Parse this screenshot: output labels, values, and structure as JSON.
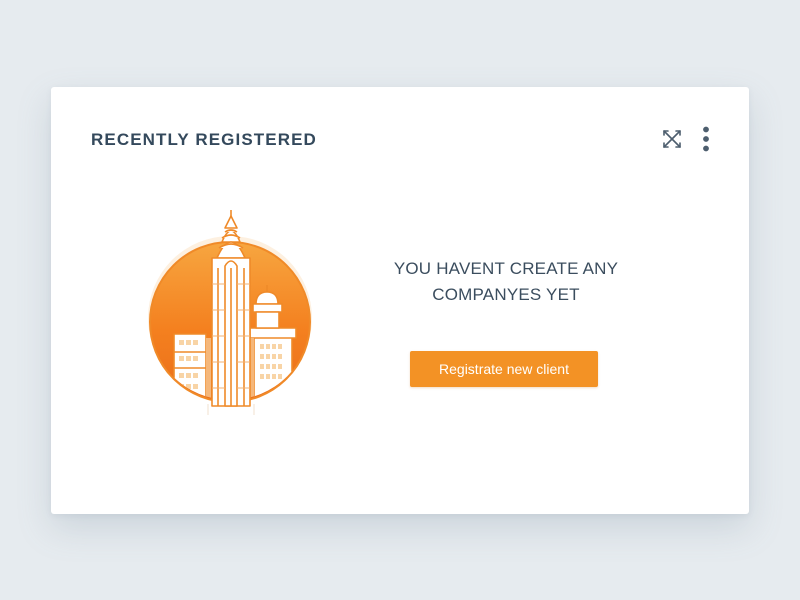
{
  "widget": {
    "title": "RECENTLY REGISTERED",
    "actions": [
      {
        "icon": "expand-arrows-icon"
      },
      {
        "icon": "more-vertical-icon"
      }
    ]
  },
  "empty_state": {
    "illustration": "city-buildings-icon",
    "message_line1": "YOU HAVENT CREATE ANY",
    "message_line2": "COMPANYES YET",
    "button_label": "Registrate new client"
  },
  "colors": {
    "background": "#e6ebef",
    "card": "#ffffff",
    "title_text": "#34495c",
    "accent": "#f39225",
    "accent_light": "#fdf0e0",
    "icon": "#4d5e6e"
  }
}
